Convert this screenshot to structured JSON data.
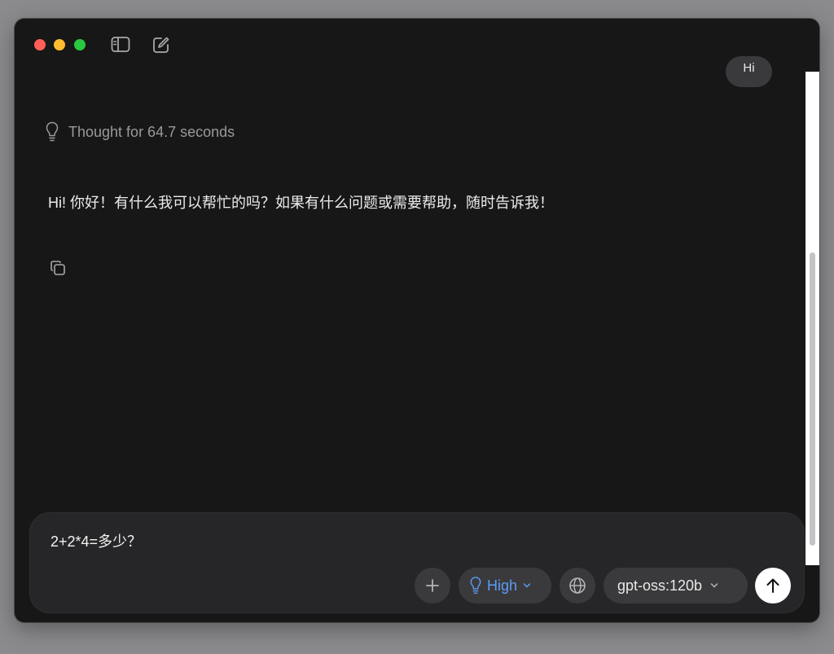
{
  "titlebar": {
    "icons": [
      "sidebar-toggle-icon",
      "new-chat-icon"
    ]
  },
  "conversation": {
    "user_message": "Hi",
    "thought_label": "Thought for 64.7 seconds",
    "assistant_message": "Hi! 你好！有什么我可以帮忙的吗？如果有什么问题或需要帮助，随时告诉我！"
  },
  "composer": {
    "input_value": "2+2*4=多少？",
    "effort_label": "High",
    "model_label": "gpt-oss:120b"
  },
  "colors": {
    "background": "#171718",
    "composer": "#262628",
    "accent": "#5b9cf5",
    "text": "#ececec",
    "muted": "#9a9a9c"
  }
}
